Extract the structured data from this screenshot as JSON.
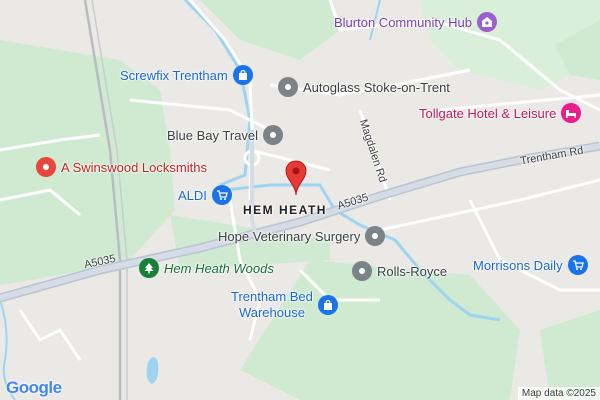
{
  "colors": {
    "land": "#ebe9e6",
    "park": "#cfead1",
    "water": "#9ed4f0",
    "road_major": "#c8cfd9",
    "road_minor": "#ffffff",
    "shop_pin": "#1a73e8",
    "generic_pin": "#7b8288",
    "red_pin": "#e8453c",
    "pink_pin": "#e91e8c",
    "purple_pin": "#9c5fd1",
    "green_pin": "#188038",
    "marker": "#e53935"
  },
  "area": {
    "name": "HEM HEATH"
  },
  "roads": {
    "a5035_west": "A5035",
    "a5035_east": "A5035",
    "magdalen": "Magdalen Rd",
    "trentham": "Trentham Rd"
  },
  "pois": {
    "blurton": {
      "name": "Blurton Community Hub",
      "icon": "community-hub-icon"
    },
    "screwfix": {
      "name": "Screwfix Trentham",
      "icon": "shopping-bag-icon"
    },
    "autoglass": {
      "name": "Autoglass Stoke-on-Trent",
      "icon": "generic-pin-icon"
    },
    "tollgate": {
      "name": "Tollgate Hotel & Leisure",
      "icon": "bed-icon"
    },
    "bluebay": {
      "name": "Blue Bay Travel",
      "icon": "generic-pin-icon"
    },
    "swinswood": {
      "name": "A Swinswood Locksmiths",
      "icon": "generic-pin-icon"
    },
    "aldi": {
      "name": "ALDI",
      "icon": "shopping-cart-icon"
    },
    "hopevet": {
      "name": "Hope Veterinary Surgery",
      "icon": "generic-pin-icon"
    },
    "hemheathwoods": {
      "name": "Hem Heath Woods",
      "icon": "tree-icon"
    },
    "rollsroyce": {
      "name": "Rolls-Royce",
      "icon": "generic-pin-icon"
    },
    "morrisons": {
      "name": "Morrisons Daily",
      "icon": "shopping-cart-icon"
    },
    "trenthambed": {
      "name_line1": "Trentham Bed",
      "name_line2": "Warehouse",
      "icon": "shopping-bag-icon"
    }
  },
  "branding": {
    "logo": "Google",
    "attribution": "Map data ©2025"
  }
}
